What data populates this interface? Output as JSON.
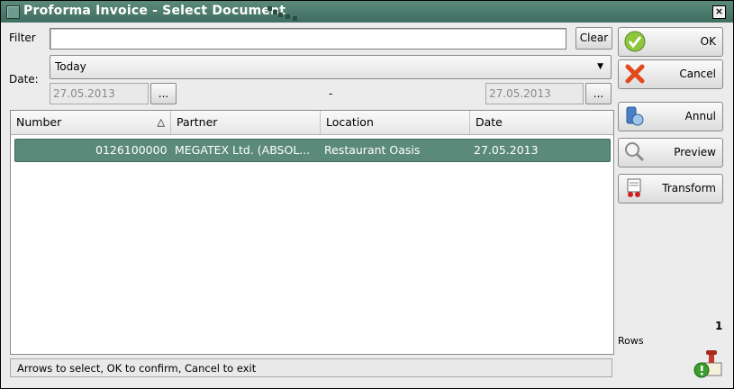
{
  "window": {
    "title": "Proforma Invoice - Select Document",
    "close_glyph": "×"
  },
  "filter": {
    "label": "Filter",
    "value": "",
    "clear_label": "Clear"
  },
  "date": {
    "label": "Date:",
    "period_selected": "Today",
    "from": "27.05.2013",
    "to": "27.05.2013",
    "separator": "-",
    "picker_label": "..."
  },
  "table": {
    "columns": [
      "Number",
      "Partner",
      "Location",
      "Date"
    ],
    "sort_indicator": "△",
    "rows": [
      {
        "number": "0126100000",
        "partner": "MEGATEX Ltd. (ABSOL...",
        "location": "Restaurant Oasis",
        "date": "27.05.2013"
      }
    ]
  },
  "status": {
    "text": "Arrows to select, OK to confirm, Cancel to exit"
  },
  "side": {
    "ok_label": "OK",
    "cancel_label": "Cancel",
    "annul_label": "Annul",
    "preview_label": "Preview",
    "transform_label": "Transform",
    "rows_count": "1",
    "rows_label": "Rows"
  },
  "colors": {
    "accent": "#5b8a7b",
    "selection": "#5b8a7b"
  },
  "icons": [
    "window-icon",
    "close-icon",
    "dropdown-arrow-icon",
    "sort-ascending-icon",
    "ok-check-icon",
    "cancel-x-icon",
    "annul-icon",
    "preview-magnifier-icon",
    "transform-icon",
    "stamp-info-icon"
  ]
}
